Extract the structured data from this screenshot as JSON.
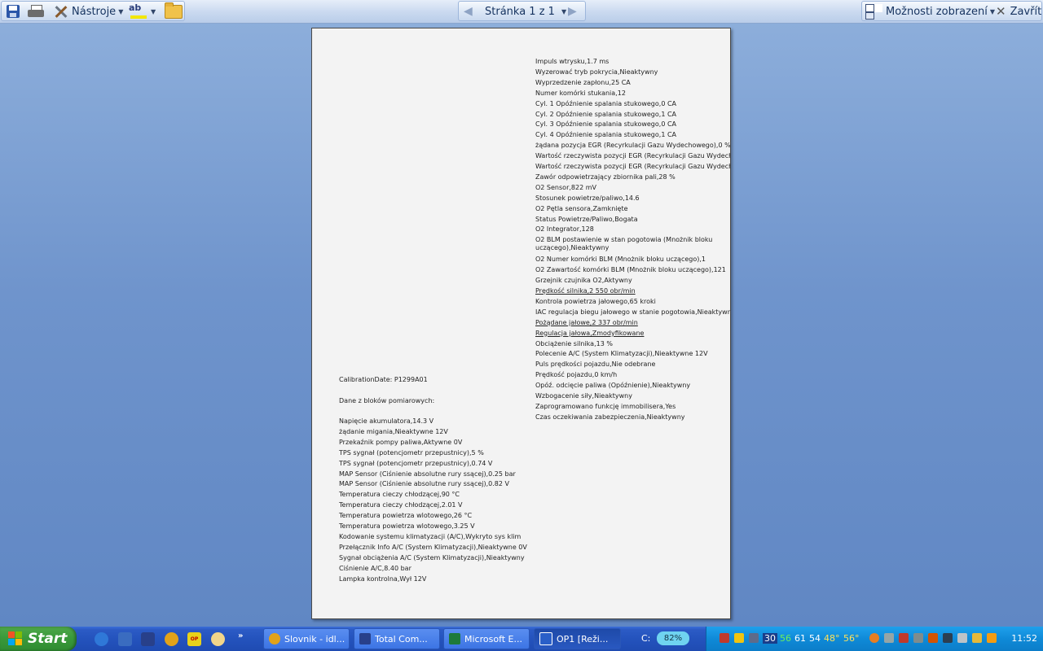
{
  "toolbar": {
    "tools_label": "Nástroje",
    "spell_label": "ab",
    "page_nav": "Stránka 1 z 1",
    "view_options": "Možnosti zobrazení",
    "close_label": "Zavřít"
  },
  "document": {
    "right_column": [
      "Impuls wtrysku,1.7  ms",
      "Wyzerować tryb pokrycia,Nieaktywny",
      "Wyprzedzenie zapłonu,25 CA",
      "Numer komórki stukania,12",
      "Cyl. 1 Opóźnienie spalania stukowego,0 CA",
      "Cyl. 2 Opóźnienie spalania stukowego,1 CA",
      "Cyl. 3 Opóźnienie spalania stukowego,0 CA",
      "Cyl. 4 Opóźnienie spalania stukowego,1 CA",
      "żądana pozycja EGR (Recyrkulacji Gazu Wydechowego),0 %",
      "Wartość rzeczywista pozycji EGR (Recyrkulacji Gazu Wydechowego)",
      "Wartość rzeczywista pozycji EGR (Recyrkulacji Gazu Wydechowego)",
      "Zawór odpowietrzający zbiornika pali,28 %",
      "O2 Sensor,822 mV",
      "Stosunek powietrze/paliwo,14.6",
      "O2 Pętla sensora,Zamknięte",
      "Status Powietrze/Paliwo,Bogata",
      "O2 Integrator,128",
      "O2 BLM postawienie w stan pogotowia (Mnożnik bloku uczącego),Nieaktywny",
      "O2 Numer komórki BLM (Mnożnik bloku uczącego),1",
      "O2 Zawartość komórki BLM (Mnożnik bloku uczącego),121",
      "Grzejnik czujnika O2,Aktywny",
      "Prędkość silnika,2 550 obr/min",
      "Kontrola powietrza jałowego,65  kroki",
      "IAC regulacja biegu jałowego w stanie pogotowia,Nieaktywny",
      "Pożądane jałowe,2 337 obr/min",
      "Regulacja jałowa,Zmodyfikowane",
      "Obciążenie silnika,13 %",
      "Polecenie A/C (System Klimatyzacji),Nieaktywne  12V",
      "Puls prędkości pojazdu,Nie odebrane",
      "Prędkość pojazdu,0 km/h",
      "Opóź. odcięcie paliwa (Opóźnienie),Nieaktywny",
      "Wzbogacenie siły,Nieaktywny",
      "Zaprogramowano  funkcję immobilisera,Yes",
      "Czas oczekiwania zabezpieczenia,Nieaktywny"
    ],
    "calibration": "CalibrationDate:  P1299A01",
    "section_title": "Dane z bloków pomiarowych:",
    "left_column": [
      "Napięcie akumulatora,14.3  V",
      "żądanie migania,Nieaktywne   12V",
      "Przekaźnik pompy paliwa,Aktywne   0V",
      "TPS sygnał (potencjometr przepustnicy),5 %",
      "TPS sygnał (potencjometr przepustnicy),0.74  V",
      "MAP Sensor (Ciśnienie absolutne rury ssącej),0.25 bar",
      "MAP Sensor (Ciśnienie absolutne rury ssącej),0.82  V",
      "Temperatura cieczy chłodzącej,90 °C",
      "Temperatura cieczy chłodzącej,2.01  V",
      "Temperatura  powietrza wlotowego,26  °C",
      "Temperatura  powietrza wlotowego,3.25  V",
      "Kodowanie systemu klimatyzacji  (A/C),Wykryto  sys klim",
      "Przełącznik Info A/C (System Klimatyzacji),Nieaktywne   0V",
      "Sygnał obciążenia A/C (System Klimatyzacji),Nieaktywny",
      "Ciśnienie A/C,8.40 bar",
      "Lampka kontrolna,Wył  12V"
    ]
  },
  "taskbar": {
    "start_label": "Start",
    "tasks": [
      "Slovnik - idl...",
      "Total Com...",
      "Microsoft E...",
      "OP1 [Reži..."
    ],
    "drive_label": "C:",
    "battery": "82%",
    "tray_numbers": [
      "30",
      "56",
      "61",
      "54",
      "48°",
      "56°"
    ],
    "clock": "11:52"
  }
}
